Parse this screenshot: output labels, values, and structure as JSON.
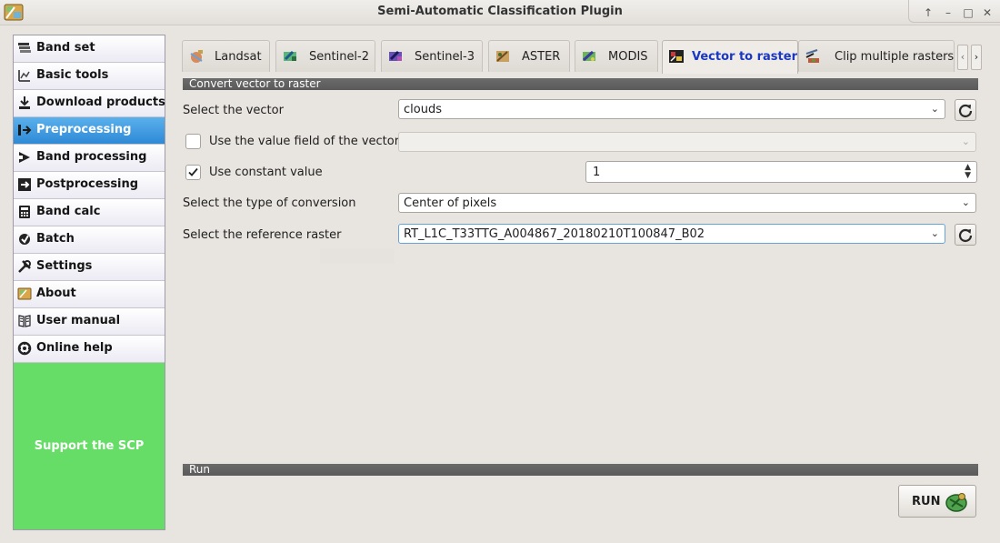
{
  "window": {
    "title": "Semi-Automatic Classification Plugin"
  },
  "sidebar": {
    "items": [
      {
        "label": "Band set",
        "icon": "band-set-icon"
      },
      {
        "label": "Basic tools",
        "icon": "basic-tools-icon"
      },
      {
        "label": "Download products",
        "icon": "download-icon"
      },
      {
        "label": "Preprocessing",
        "icon": "preprocessing-icon",
        "active": true
      },
      {
        "label": "Band processing",
        "icon": "band-processing-icon"
      },
      {
        "label": "Postprocessing",
        "icon": "postprocessing-icon"
      },
      {
        "label": "Band calc",
        "icon": "band-calc-icon"
      },
      {
        "label": "Batch",
        "icon": "batch-icon"
      },
      {
        "label": "Settings",
        "icon": "settings-icon"
      },
      {
        "label": "About",
        "icon": "about-icon"
      },
      {
        "label": "User manual",
        "icon": "user-manual-icon"
      },
      {
        "label": "Online help",
        "icon": "online-help-icon"
      }
    ],
    "support_label": "Support the SCP"
  },
  "tabs": [
    {
      "label": "Landsat"
    },
    {
      "label": "Sentinel-2"
    },
    {
      "label": "Sentinel-3"
    },
    {
      "label": "ASTER"
    },
    {
      "label": "MODIS"
    },
    {
      "label": "Vector to raster",
      "active": true
    },
    {
      "label": "Clip multiple rasters"
    }
  ],
  "convert": {
    "header": "Convert vector to raster",
    "vector_label": "Select the vector",
    "vector_value": "clouds",
    "value_field_label": "Use the value field of the vector",
    "value_field_value": "",
    "value_field_checked": false,
    "constant_label": "Use constant value",
    "constant_checked": true,
    "constant_value": "1",
    "conversion_label": "Select the type of conversion",
    "conversion_value": "Center of pixels",
    "reference_label": "Select the reference raster",
    "reference_value": "RT_L1C_T33TTG_A004867_20180210T100847_B02"
  },
  "run": {
    "header": "Run",
    "button_label": "RUN"
  },
  "colors": {
    "active_nav": "#3a94dc",
    "support_bg": "#66dd66",
    "active_tab_text": "#1a37c4",
    "section_header": "#606060"
  }
}
